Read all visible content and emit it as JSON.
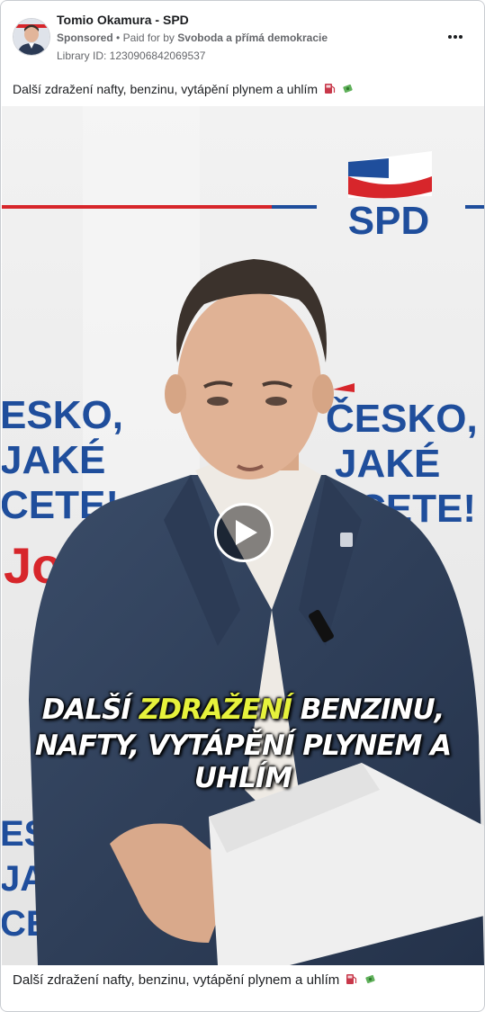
{
  "ad": {
    "page_name": "Tomio Okamura - SPD",
    "sponsored_label": "Sponsored",
    "separator": "•",
    "paid_for_prefix": "Paid for by",
    "paid_for_by": "Svoboda a přímá demokracie",
    "library_id": "Library ID: 1230906842069537",
    "more_icon": "more-options-icon",
    "caption": "Další zdražení nafty, benzinu, vytápění plynem a uhlím"
  },
  "video": {
    "backdrop_logo": "SPD",
    "backdrop_slogan_left": [
      "ESKO,",
      "JAKÉ",
      "CETE!"
    ],
    "backdrop_slogan_right": [
      "ČESKO,",
      "JAKÉ",
      "CETE!"
    ],
    "backdrop_slogan_bottom": [
      "ESK",
      "JAKÉ",
      "CETE"
    ],
    "subtitle_line1_a": "DALŠÍ",
    "subtitle_line1_highlight": "ZDRAŽENÍ",
    "subtitle_line1_b": "BENZINU,",
    "subtitle_line2": "NAFTY, VYTÁPĚNÍ PLYNEM A UHLÍM",
    "play_icon": "play-icon",
    "highlight_color": "#e6f23c"
  },
  "footer": {
    "caption": "Další zdražení nafty, benzinu, vytápění plynem a uhlím"
  },
  "colors": {
    "spd_blue": "#1f4e9c",
    "spd_red": "#d7262b",
    "text_primary": "#1c1e21",
    "text_secondary": "#65676b"
  }
}
